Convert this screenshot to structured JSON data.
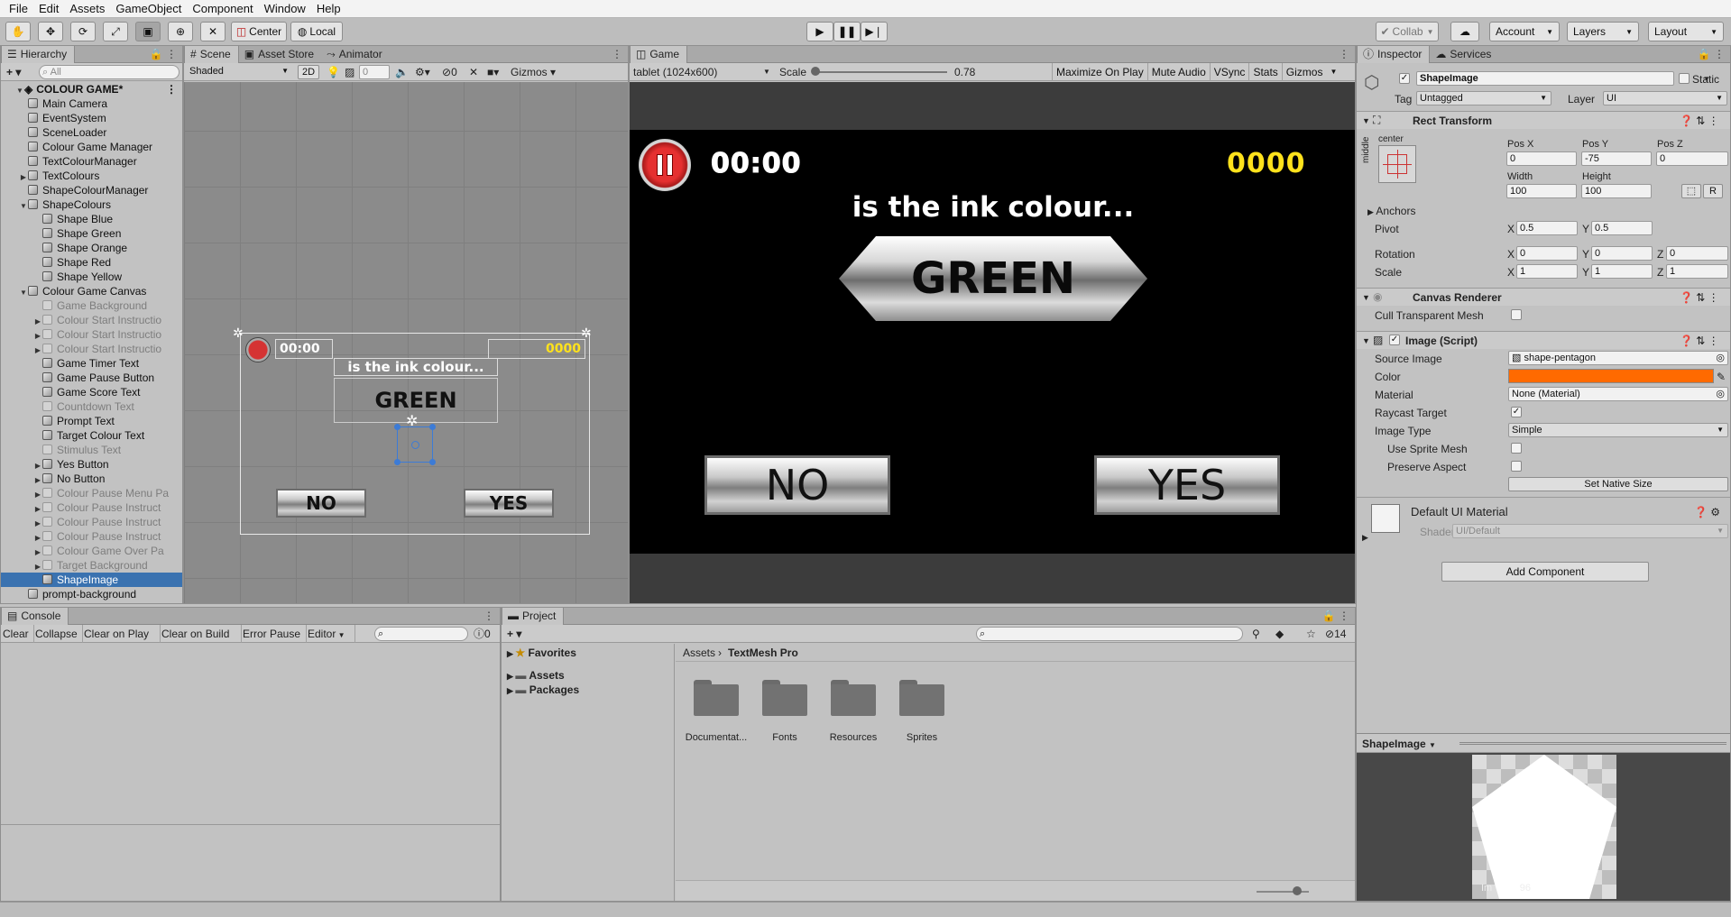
{
  "menu": [
    "File",
    "Edit",
    "Assets",
    "GameObject",
    "Component",
    "Window",
    "Help"
  ],
  "toolbar": {
    "pivot_mode": "Center",
    "pivot_rotation": "Local",
    "collab": "Collab",
    "account": "Account",
    "layers": "Layers",
    "layout": "Layout"
  },
  "hierarchy": {
    "tab": "Hierarchy",
    "search_placeholder": "All",
    "add_label": "+",
    "scene": "COLOUR GAME*",
    "items": [
      {
        "label": "Main Camera",
        "indent": 1,
        "dim": false,
        "arrow": ""
      },
      {
        "label": "EventSystem",
        "indent": 1,
        "dim": false,
        "arrow": ""
      },
      {
        "label": "SceneLoader",
        "indent": 1,
        "dim": false,
        "arrow": ""
      },
      {
        "label": "Colour Game Manager",
        "indent": 1,
        "dim": false,
        "arrow": ""
      },
      {
        "label": "TextColourManager",
        "indent": 1,
        "dim": false,
        "arrow": ""
      },
      {
        "label": "TextColours",
        "indent": 1,
        "dim": false,
        "arrow": "▶"
      },
      {
        "label": "ShapeColourManager",
        "indent": 1,
        "dim": false,
        "arrow": ""
      },
      {
        "label": "ShapeColours",
        "indent": 1,
        "dim": false,
        "arrow": "▼"
      },
      {
        "label": "Shape Blue",
        "indent": 2,
        "dim": false,
        "arrow": ""
      },
      {
        "label": "Shape Green",
        "indent": 2,
        "dim": false,
        "arrow": ""
      },
      {
        "label": "Shape Orange",
        "indent": 2,
        "dim": false,
        "arrow": ""
      },
      {
        "label": "Shape Red",
        "indent": 2,
        "dim": false,
        "arrow": ""
      },
      {
        "label": "Shape Yellow",
        "indent": 2,
        "dim": false,
        "arrow": ""
      },
      {
        "label": "Colour Game Canvas",
        "indent": 1,
        "dim": false,
        "arrow": "▼"
      },
      {
        "label": "Game Background",
        "indent": 2,
        "dim": true,
        "arrow": ""
      },
      {
        "label": "Colour Start Instructio",
        "indent": 2,
        "dim": true,
        "arrow": "▶"
      },
      {
        "label": "Colour Start Instructio",
        "indent": 2,
        "dim": true,
        "arrow": "▶"
      },
      {
        "label": "Colour Start Instructio",
        "indent": 2,
        "dim": true,
        "arrow": "▶"
      },
      {
        "label": "Game Timer Text",
        "indent": 2,
        "dim": false,
        "arrow": ""
      },
      {
        "label": "Game Pause Button",
        "indent": 2,
        "dim": false,
        "arrow": ""
      },
      {
        "label": "Game Score Text",
        "indent": 2,
        "dim": false,
        "arrow": ""
      },
      {
        "label": "Countdown Text",
        "indent": 2,
        "dim": true,
        "arrow": ""
      },
      {
        "label": "Prompt Text",
        "indent": 2,
        "dim": false,
        "arrow": ""
      },
      {
        "label": "Target Colour Text",
        "indent": 2,
        "dim": false,
        "arrow": ""
      },
      {
        "label": "Stimulus Text",
        "indent": 2,
        "dim": true,
        "arrow": ""
      },
      {
        "label": "Yes Button",
        "indent": 2,
        "dim": false,
        "arrow": "▶"
      },
      {
        "label": "No Button",
        "indent": 2,
        "dim": false,
        "arrow": "▶"
      },
      {
        "label": "Colour Pause Menu Pa",
        "indent": 2,
        "dim": true,
        "arrow": "▶"
      },
      {
        "label": "Colour Pause Instruct",
        "indent": 2,
        "dim": true,
        "arrow": "▶"
      },
      {
        "label": "Colour Pause Instruct",
        "indent": 2,
        "dim": true,
        "arrow": "▶"
      },
      {
        "label": "Colour Pause Instruct",
        "indent": 2,
        "dim": true,
        "arrow": "▶"
      },
      {
        "label": "Colour Game Over Pa",
        "indent": 2,
        "dim": true,
        "arrow": "▶"
      },
      {
        "label": "Target Background",
        "indent": 2,
        "dim": true,
        "arrow": "▶"
      },
      {
        "label": "ShapeImage",
        "indent": 2,
        "dim": false,
        "arrow": "",
        "selected": true
      },
      {
        "label": "prompt-background",
        "indent": 1,
        "dim": false,
        "arrow": ""
      }
    ]
  },
  "scene": {
    "tabs": [
      "Scene",
      "Asset Store",
      "Animator"
    ],
    "shading": "Shaded",
    "mode_2d": "2D",
    "fx_count": "0",
    "hidden_count": "0",
    "gizmos": "Gizmos",
    "timer": "00:00",
    "score": "0000",
    "prompt": "is the ink colour...",
    "target": "GREEN",
    "no": "NO",
    "yes": "YES"
  },
  "game": {
    "tab": "Game",
    "resolution": "tablet (1024x600)",
    "scale_label": "Scale",
    "scale_value": "0.78",
    "scale_level": 0.0,
    "buttons": [
      "Maximize On Play",
      "Mute Audio",
      "VSync",
      "Stats",
      "Gizmos"
    ],
    "timer": "00:00",
    "score": "0000",
    "prompt": "is the ink colour...",
    "target": "GREEN",
    "no": "NO",
    "yes": "YES"
  },
  "console": {
    "tab": "Console",
    "buttons": [
      "Clear",
      "Collapse",
      "Clear on Play",
      "Clear on Build",
      "Error Pause",
      "Editor"
    ],
    "count": "0"
  },
  "project": {
    "tab": "Project",
    "count": "14",
    "favorites": "Favorites",
    "tree": [
      "Assets",
      "Packages"
    ],
    "breadcrumb": [
      "Assets",
      "TextMesh Pro"
    ],
    "folders": [
      "Documentat...",
      "Fonts",
      "Resources",
      "Sprites"
    ]
  },
  "inspector": {
    "tabs": [
      "Inspector",
      "Services"
    ],
    "object_name": "ShapeImage",
    "static": "Static",
    "tag_label": "Tag",
    "tag": "Untagged",
    "layer_label": "Layer",
    "layer": "UI",
    "rect_transform": {
      "title": "Rect Transform",
      "anchor_h": "center",
      "anchor_v": "middle",
      "labels": [
        "Pos X",
        "Pos Y",
        "Pos Z",
        "Width",
        "Height"
      ],
      "pos_x": "0",
      "pos_y": "-75",
      "pos_z": "0",
      "width": "100",
      "height": "100",
      "anchors": "Anchors",
      "pivot_label": "Pivot",
      "pivot_x": "0.5",
      "pivot_y": "0.5",
      "rotation_label": "Rotation",
      "rot_x": "0",
      "rot_y": "0",
      "rot_z": "0",
      "scale_label": "Scale",
      "scale_x": "1",
      "scale_y": "1",
      "scale_z": "1",
      "axis_x": "X",
      "axis_y": "Y",
      "axis_z": "Z",
      "r_button": "R"
    },
    "canvas_renderer": {
      "title": "Canvas Renderer",
      "cull_label": "Cull Transparent Mesh"
    },
    "image": {
      "title": "Image (Script)",
      "source_label": "Source Image",
      "source": "shape-pentagon",
      "color_label": "Color",
      "color": "#ff6a00",
      "material_label": "Material",
      "material": "None (Material)",
      "raycast_label": "Raycast Target",
      "type_label": "Image Type",
      "type": "Simple",
      "sprite_mesh_label": "Use Sprite Mesh",
      "preserve_label": "Preserve Aspect",
      "native_size": "Set Native Size"
    },
    "material": {
      "title": "Default UI Material",
      "shader_label": "Shader",
      "shader": "UI/Default"
    },
    "add_component": "Add Component",
    "preview_title": "ShapeImage",
    "preview_caption": "Im          96"
  }
}
